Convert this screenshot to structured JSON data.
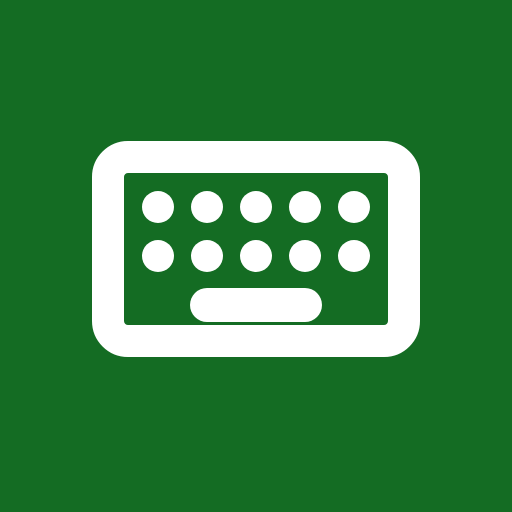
{
  "icon": {
    "name": "keyboard-icon",
    "background_color": "#146c23",
    "foreground_color": "#ffffff"
  }
}
